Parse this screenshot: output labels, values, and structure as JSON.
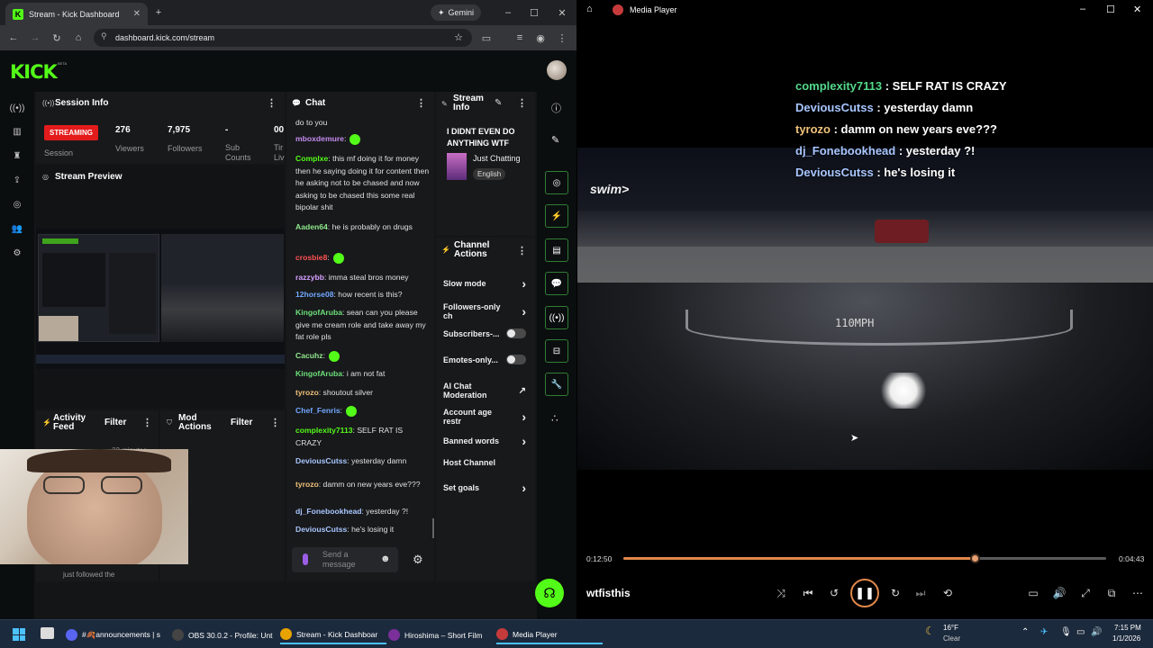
{
  "browser": {
    "tab_title": "Stream - Kick Dashboard",
    "gemini_label": "Gemini",
    "url": "dashboard.kick.com/stream"
  },
  "kick": {
    "logo": "KICK",
    "beta": "BETA"
  },
  "session": {
    "title": "Session Info",
    "status": "STREAMING",
    "status_label": "Session",
    "stats": [
      {
        "value": "276",
        "label": "Viewers"
      },
      {
        "value": "7,975",
        "label": "Followers"
      },
      {
        "value": "-",
        "label": "Sub Counts"
      },
      {
        "value": "00",
        "label": "Tir Liv"
      }
    ]
  },
  "preview": {
    "title": "Stream Preview"
  },
  "activity": {
    "title": "Activity Feed",
    "filter": "Filter",
    "time": "22 minutes ago",
    "item": "just followed the"
  },
  "mod": {
    "title": "Mod Actions",
    "filter": "Filter"
  },
  "chat": {
    "title": "Chat",
    "messages": [
      {
        "user": "",
        "color": "#e0e0e0",
        "text": "do to you"
      },
      {
        "user": "mboxdemure",
        "color": "#c58cf0",
        "text": ":",
        "emote": true
      },
      {
        "user": "Complxe",
        "color": "#53fc18",
        "text": ": this mf doing it for money then he saying doing it for content then he asking not to be chased and now asking to be chased this some real bipolar shit"
      },
      {
        "user": "Aaden64",
        "color": "#8fe88c",
        "text": ": he is probably on drugs"
      },
      {
        "user": "crosbie8",
        "color": "#ff5252",
        "text": ":",
        "emote": true
      },
      {
        "user": "razzybb",
        "color": "#d6a0ff",
        "text": ": imma steal bros money"
      },
      {
        "user": "12horse08",
        "color": "#71a8ff",
        "text": ": how recent is this?"
      },
      {
        "user": "KingofAruba",
        "color": "#6de07a",
        "text": ": sean can you please give me cream role and take away my fat role pls"
      },
      {
        "user": "Cacuhz",
        "color": "#8fe88c",
        "text": ":",
        "emote": true
      },
      {
        "user": "KingofAruba",
        "color": "#6de07a",
        "text": ": i am not fat"
      },
      {
        "user": "tyrozo",
        "color": "#f0c27a",
        "text": ": shoutout silver"
      },
      {
        "user": "Chef_Fenris",
        "color": "#71a8ff",
        "text": ":",
        "emote": true
      },
      {
        "user": "complexity7113",
        "color": "#53fc18",
        "text": ": SELF RAT IS CRAZY"
      },
      {
        "user": "DeviousCutss",
        "color": "#a8c6ff",
        "text": ": yesterday damn"
      },
      {
        "user": "tyrozo",
        "color": "#f0c27a",
        "text": ": damm on new years eve???"
      },
      {
        "user": "dj_Fonebookhead",
        "color": "#a8c6ff",
        "text": ": yesterday ?!"
      },
      {
        "user": "DeviousCutss",
        "color": "#a8c6ff",
        "text": ": he's losing it"
      }
    ],
    "placeholder": "Send a message"
  },
  "stream_info": {
    "title": "Stream Info",
    "stream_title": "I DIDNT EVEN DO ANYTHING WTF",
    "category": "Just Chatting",
    "language": "English"
  },
  "channel_actions": {
    "title": "Channel Actions",
    "items": [
      {
        "label": "Slow mode",
        "kind": "arrow"
      },
      {
        "label": "Followers-only ch",
        "kind": "arrow"
      },
      {
        "label": "Subscribers-...",
        "kind": "toggle"
      },
      {
        "label": "Emotes-only...",
        "kind": "toggle"
      },
      {
        "label": "AI Chat Moderation",
        "kind": "external"
      },
      {
        "label": "Account age restr",
        "kind": "arrow"
      },
      {
        "label": "Banned words",
        "kind": "arrow"
      },
      {
        "label": "Host Channel",
        "kind": "none"
      },
      {
        "label": "Set goals",
        "kind": "arrow"
      }
    ]
  },
  "player": {
    "title": "Media Player",
    "overlay": [
      {
        "user": "complexity7113",
        "color": "#53d98a",
        "text": " : SELF RAT IS CRAZY"
      },
      {
        "user": "DeviousCutss",
        "color": "#a8c6ff",
        "text": " : yesterday damn"
      },
      {
        "user": "tyrozo",
        "color": "#f0c27a",
        "text": " : damm on new years eve???"
      },
      {
        "user": "dj_Fonebookhead",
        "color": "#a8c6ff",
        "text": " : yesterday ?!"
      },
      {
        "user": "DeviousCutss",
        "color": "#a8c6ff",
        "text": " : he's losing it"
      }
    ],
    "watermark": "swim>",
    "speed": "110MPH",
    "elapsed": "0:12:50",
    "remaining": "0:04:43",
    "progress": 0.728,
    "media_title": "wtfisthis"
  },
  "taskbar": {
    "items": [
      {
        "label": "#🍂announcements | s",
        "color": "#5865f2"
      },
      {
        "label": "OBS 30.0.2 - Profile: Unt",
        "color": "#444"
      },
      {
        "label": "Stream - Kick Dashboar",
        "color": "#e9a300"
      },
      {
        "label": "Hiroshima – Short Film",
        "color": "#7a2f9a"
      },
      {
        "label": "Media Player",
        "color": "#c53b3b"
      }
    ],
    "weather_temp": "16°F",
    "weather_desc": "Clear",
    "time": "7:15 PM",
    "date": "1/1/2026"
  }
}
